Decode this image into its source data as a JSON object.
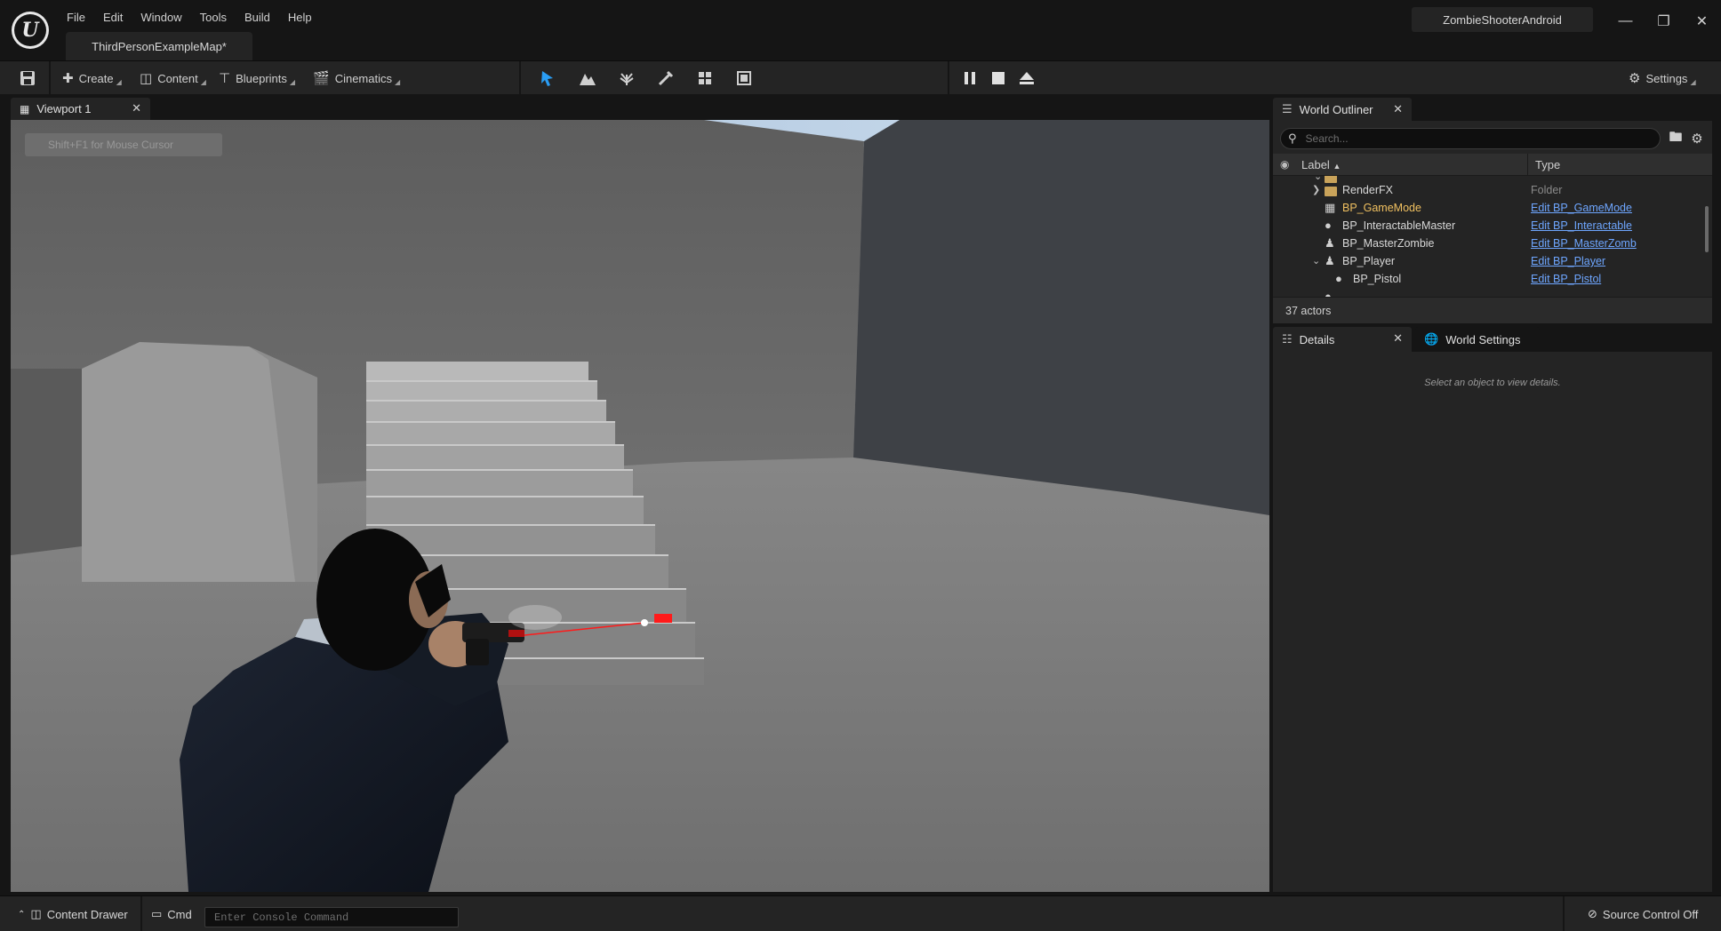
{
  "menu": [
    "File",
    "Edit",
    "Window",
    "Tools",
    "Build",
    "Help"
  ],
  "map_tab": "ThirdPersonExampleMap*",
  "project_name": "ZombieShooterAndroid",
  "toolbar": {
    "create": "Create",
    "content": "Content",
    "blueprints": "Blueprints",
    "cinematics": "Cinematics",
    "settings": "Settings"
  },
  "viewport": {
    "tab_label": "Viewport 1",
    "hint": "Shift+F1 for Mouse Cursor"
  },
  "outliner": {
    "tab_label": "World Outliner",
    "search_placeholder": "Search...",
    "col_label": "Label",
    "col_type": "Type",
    "rows": [
      {
        "name": "RenderFX",
        "type": "Folder"
      },
      {
        "name": "BP_GameMode",
        "type": "Edit BP_GameMode"
      },
      {
        "name": "BP_InteractableMaster",
        "type": "Edit BP_Interactable"
      },
      {
        "name": "BP_MasterZombie",
        "type": "Edit BP_MasterZomb"
      },
      {
        "name": "BP_Player",
        "type": "Edit BP_Player"
      },
      {
        "name": "BP_Pistol",
        "type": "Edit BP_Pistol"
      }
    ],
    "actor_count": "37 actors"
  },
  "details": {
    "tab_label": "Details",
    "world_settings_label": "World Settings",
    "empty_hint": "Select an object to view details."
  },
  "statusbar": {
    "content_drawer": "Content Drawer",
    "cmd": "Cmd",
    "console_placeholder": "Enter Console Command",
    "source_control": "Source Control Off"
  },
  "colors": {
    "accent_blue": "#2a9df4",
    "link_blue": "#6ea6ff",
    "panel_bg": "#242424",
    "editor_bg": "#151515",
    "laser_red": "#ff1a1a"
  }
}
